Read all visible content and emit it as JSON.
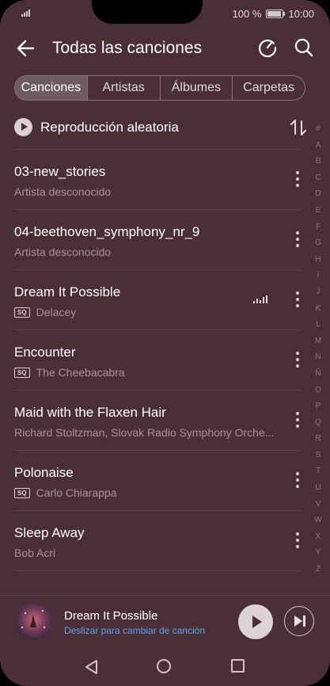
{
  "status": {
    "battery": "100 %",
    "time": "10:00",
    "battery_level": 1.0
  },
  "header": {
    "title": "Todas las canciones"
  },
  "tabs": [
    {
      "label": "Canciones",
      "active": true
    },
    {
      "label": "Artistas",
      "active": false
    },
    {
      "label": "Álbumes",
      "active": false
    },
    {
      "label": "Carpetas",
      "active": false
    }
  ],
  "shuffle": {
    "label": "Reproducción aleatoria"
  },
  "songs": [
    {
      "title": "03-new_stories",
      "artist": "Artista desconocido",
      "sq": false,
      "playing": false
    },
    {
      "title": "04-beethoven_symphony_nr_9",
      "artist": "Artista desconocido",
      "sq": false,
      "playing": false
    },
    {
      "title": "Dream It Possible",
      "artist": "Delacey",
      "sq": true,
      "playing": true
    },
    {
      "title": "Encounter",
      "artist": "The Cheebacabra",
      "sq": true,
      "playing": false
    },
    {
      "title": "Maid with the Flaxen Hair",
      "artist": "Richard Stoltzman, Slovak Radio Symphony Orche...",
      "sq": false,
      "playing": false
    },
    {
      "title": "Polonaise",
      "artist": "Carlo Chiarappa",
      "sq": true,
      "playing": false
    },
    {
      "title": "Sleep Away",
      "artist": "Bob Acri",
      "sq": false,
      "playing": false
    }
  ],
  "sq_label": "SQ",
  "alphabet": [
    "#",
    "A",
    "B",
    "C",
    "D",
    "E",
    "F",
    "G",
    "H",
    "I",
    "J",
    "K",
    "L",
    "M",
    "N",
    "Ñ",
    "O",
    "P",
    "Q",
    "R",
    "S",
    "T",
    "U",
    "V",
    "W",
    "X",
    "Y",
    "Z"
  ],
  "now_playing": {
    "title": "Dream It Possible",
    "hint": "Deslizar para cambiar de canción"
  },
  "colors": {
    "background": "#4a2f37",
    "accent": "#5aa2f0",
    "divider": "#5d4249"
  }
}
